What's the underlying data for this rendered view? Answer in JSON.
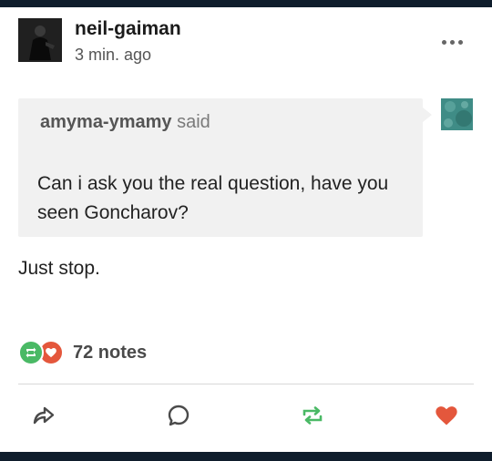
{
  "post": {
    "username": "neil-gaiman",
    "timestamp": "3 min. ago"
  },
  "quote": {
    "author": "amyma-ymamy",
    "said_label": "said",
    "text": "Can i ask you the real question, have you seen Goncharov?"
  },
  "reply": {
    "text": "Just stop."
  },
  "notes": {
    "count_label": "72 notes"
  },
  "icons": {
    "more": "more-options-icon",
    "share": "share-icon",
    "reply": "reply-icon",
    "reblog": "reblog-icon",
    "like": "heart-icon"
  },
  "colors": {
    "reblog_green": "#4ab965",
    "like_red": "#e4573c",
    "frame_navy": "#0f1d2c",
    "quote_background": "#f1f1f1"
  }
}
